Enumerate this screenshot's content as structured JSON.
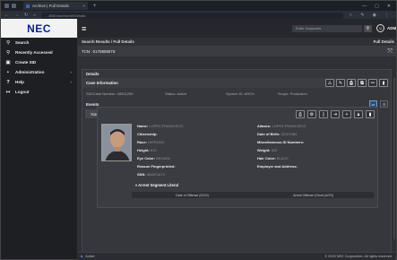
{
  "browser": {
    "tab_title": "Archive | Full Details",
    "tab_close": "×",
    "new_tab": "+",
    "url": "...:8080/archive/#!/Details",
    "nav": {
      "back": "←",
      "forward": "→",
      "reload": "↻",
      "home": "⌂"
    }
  },
  "brand": {
    "logo_text": "NEC"
  },
  "sidebar": {
    "items": [
      {
        "icon": "search-icon",
        "glyph": "⚲",
        "label": "Search"
      },
      {
        "icon": "recent-icon",
        "glyph": "⚲",
        "label": "Recently Accessed"
      },
      {
        "icon": "create-icon",
        "glyph": "▣",
        "label": "Create SID"
      },
      {
        "icon": "admin-icon",
        "glyph": "▪",
        "label": "Administration",
        "chevron": "›"
      },
      {
        "icon": "help-icon",
        "glyph": "?",
        "label": "Help",
        "chevron": "›"
      },
      {
        "icon": "logout-icon",
        "glyph": "↦",
        "label": "Logout"
      }
    ]
  },
  "topbar": {
    "keyword_placeholder": "Enter Keywords",
    "user_label": "ADMIN"
  },
  "breadcrumb": {
    "left": "Search Results / Full Details",
    "right": "Full Details"
  },
  "tcn_header": "TCN : 017080907S",
  "details": {
    "section_title": "Details",
    "case_title": "Case Information",
    "info": [
      "SID/Case Number: 28001255",
      "Status: Active",
      "System ID: ARCH",
      "Scope: Production"
    ]
  },
  "events": {
    "title": "Events",
    "tabs": [
      "TCN : 017080907S",
      "TCN : 0170809ET",
      "TCN : 0709121DE",
      "TCN : 0709121DS",
      "TCN : 0R111020",
      "TCN : 08082020",
      "TCN : 28001255_COMPOSITE"
    ]
  },
  "subject": {
    "left": [
      {
        "label": "Name:",
        "value": "LOPEZ,FRANCISCO"
      },
      {
        "label": "Citizenship:",
        "value": ""
      },
      {
        "label": "Race:",
        "value": "HISPANIC"
      },
      {
        "label": "Height:",
        "value": "510"
      },
      {
        "label": "Eye Color:",
        "value": "BROWN"
      },
      {
        "label": "Reason Fingerprinted:",
        "value": ""
      },
      {
        "label": "SSN:",
        "value": "564871573"
      }
    ],
    "right": [
      {
        "label": "Aliases:",
        "value": "LOPEZ,FRANCISCO"
      },
      {
        "label": "Date of Birth:",
        "value": "3/10/1984"
      },
      {
        "label": "Miscellaneous ID Numbers:",
        "value": ""
      },
      {
        "label": "Weight:",
        "value": "320"
      },
      {
        "label": "Hair Color:",
        "value": "BLACK"
      },
      {
        "label": "Employer and Address:",
        "value": ""
      }
    ],
    "arrest_title": "▾ Arrest Segment Literal",
    "arrest_cols": [
      "Date of Offense (DOO)",
      "Arrest Offense (Short (AOS)"
    ]
  },
  "footer": {
    "status": "Active",
    "copyright": "© 2020 NEC Corporation. All rights reserved."
  }
}
